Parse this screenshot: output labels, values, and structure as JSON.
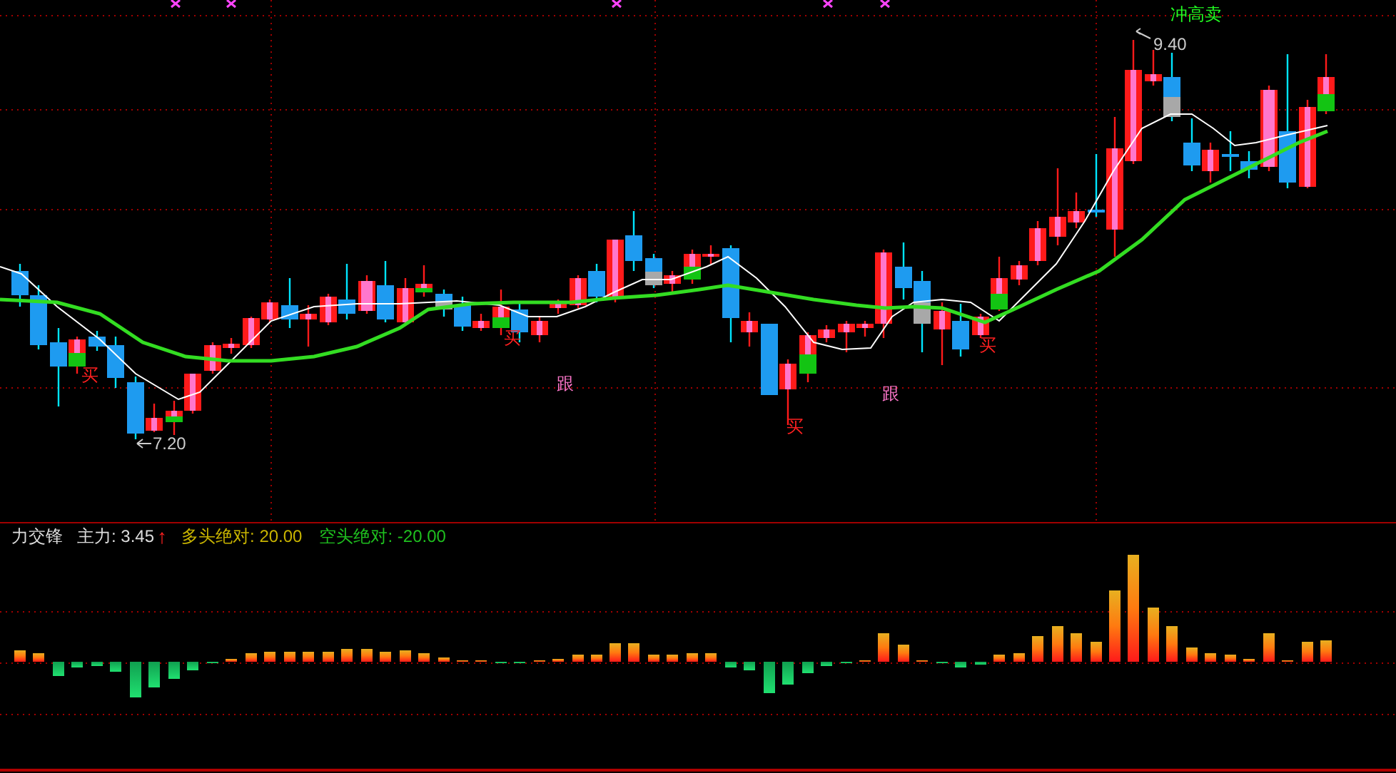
{
  "chart": {
    "signals": [
      {
        "text": "冲高卖",
        "kind": "sell"
      },
      {
        "text": "买",
        "kind": "buy"
      },
      {
        "text": "买",
        "kind": "buy"
      },
      {
        "text": "跟",
        "kind": "follow"
      },
      {
        "text": "买",
        "kind": "buy"
      },
      {
        "text": "跟",
        "kind": "follow"
      },
      {
        "text": "买",
        "kind": "buy"
      }
    ],
    "high_label": "9.40",
    "low_label": "7.20"
  },
  "indicator": {
    "name": "力交锋",
    "main_label": "主力: 3.45",
    "trend_arrow": "↑",
    "bull_label": "多头绝对: 20.00",
    "bear_label": "空头绝对: -20.00"
  }
}
